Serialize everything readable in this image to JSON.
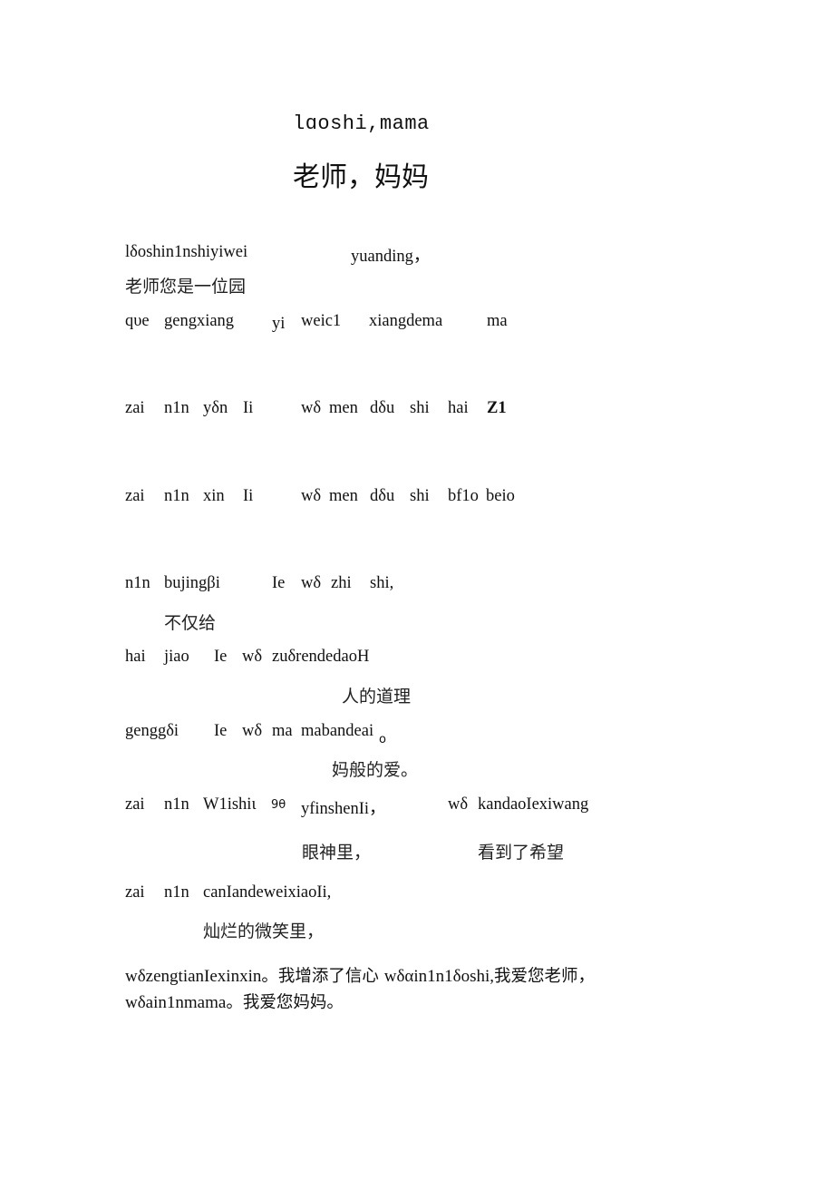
{
  "title": {
    "pinyin": "lɑoshi,mama",
    "chinese": "老师，妈妈"
  },
  "lines": [
    {
      "id": "l1",
      "pinyin": [
        "lδoshin1nshiyiwei",
        "yuanding，"
      ],
      "chinese": [
        "老师您是一位园"
      ]
    },
    {
      "id": "l2",
      "pinyin": [
        "qυe",
        "gengxiang",
        "yi",
        "weic1",
        "xiangdema",
        "ma"
      ]
    },
    {
      "id": "l3",
      "pinyin": [
        "zai",
        "n1n",
        "yδn",
        "Ii",
        "wδ",
        "men",
        "dδu",
        "shi",
        "hai",
        "Z1"
      ]
    },
    {
      "id": "l4",
      "pinyin": [
        "zai",
        "n1n",
        "xin",
        "Ii",
        "wδ",
        "men",
        "dδu",
        "shi",
        "bf1o",
        "beio"
      ]
    },
    {
      "id": "l5",
      "pinyin": [
        "n1n",
        "bujingβi",
        "Ie",
        "wδ",
        "zhi",
        "shi,"
      ],
      "chinese": [
        "不仅给"
      ]
    },
    {
      "id": "l6",
      "pinyin": [
        "hai",
        "jiao",
        "Ie",
        "wδ",
        "zuδrendedaoH"
      ],
      "chinese": [
        "人的道理"
      ]
    },
    {
      "id": "l7",
      "pinyin": [
        "genggδi",
        "Ie",
        "wδ",
        "ma",
        "mabandeai",
        "o"
      ],
      "chinese": [
        "妈般的爱。"
      ]
    },
    {
      "id": "l8",
      "pinyin": [
        "zai",
        "n1n",
        "W1ishiι",
        "9θ",
        "yfinshenIi，",
        "wδ",
        "kandaoIexiwang"
      ],
      "chinese": [
        "眼神里，",
        "看到了希望"
      ]
    },
    {
      "id": "l9",
      "pinyin": [
        "zai",
        "n1n",
        "canIandeweixiaoIi,"
      ],
      "chinese": [
        "灿烂的微笑里，"
      ]
    }
  ],
  "closing": {
    "part1": "wδzengtianIexinxin",
    "part2": "。我增添了信心 ",
    "part3": "wδαin1n1δoshi,",
    "part4": "我爱您老师，",
    "part5": "wδain1nmama",
    "part6": "。我爱您妈妈。"
  }
}
